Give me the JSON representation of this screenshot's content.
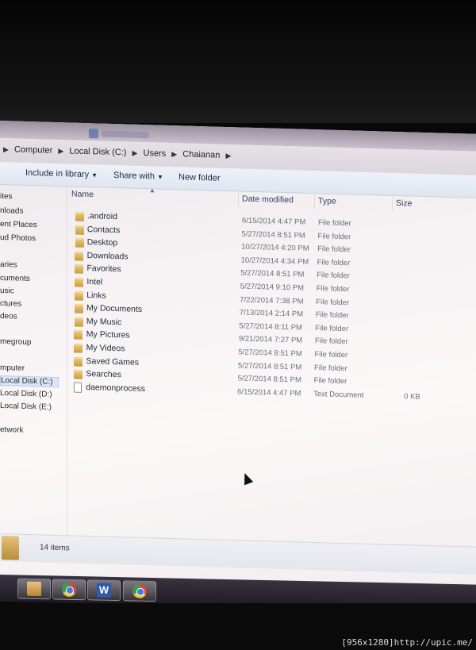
{
  "breadcrumb": [
    "Computer",
    "Local Disk (C:)",
    "Users",
    "Chaianan"
  ],
  "toolbar": {
    "include_in_library": "Include in library",
    "share_with": "Share with",
    "new_folder": "New folder"
  },
  "nav_pane": [
    "ites",
    "nloads",
    "ent Places",
    "ud Photos",
    "aries",
    "cuments",
    "usic",
    "ctures",
    "deos",
    "megroup",
    "mputer",
    "Local Disk (C:)",
    "Local Disk (D:)",
    "Local Disk (E:)",
    "etwork"
  ],
  "columns": {
    "name": "Name",
    "date": "Date modified",
    "type": "Type",
    "size": "Size"
  },
  "files": [
    {
      "name": ".android",
      "date": "6/15/2014 4:47 PM",
      "type": "File folder",
      "size": "",
      "icon": "folder-icon"
    },
    {
      "name": "Contacts",
      "date": "5/27/2014 8:51 PM",
      "type": "File folder",
      "size": "",
      "icon": "contacts-folder-icon"
    },
    {
      "name": "Desktop",
      "date": "10/27/2014 4:20 PM",
      "type": "File folder",
      "size": "",
      "icon": "desktop-folder-icon"
    },
    {
      "name": "Downloads",
      "date": "10/27/2014 4:34 PM",
      "type": "File folder",
      "size": "",
      "icon": "downloads-folder-icon"
    },
    {
      "name": "Favorites",
      "date": "5/27/2014 8:51 PM",
      "type": "File folder",
      "size": "",
      "icon": "favorites-folder-icon"
    },
    {
      "name": "Intel",
      "date": "5/27/2014 9:10 PM",
      "type": "File folder",
      "size": "",
      "icon": "folder-icon"
    },
    {
      "name": "Links",
      "date": "7/22/2014 7:38 PM",
      "type": "File folder",
      "size": "",
      "icon": "links-folder-icon"
    },
    {
      "name": "My Documents",
      "date": "7/13/2014 2:14 PM",
      "type": "File folder",
      "size": "",
      "icon": "documents-folder-icon"
    },
    {
      "name": "My Music",
      "date": "5/27/2014 8:11 PM",
      "type": "File folder",
      "size": "",
      "icon": "music-folder-icon"
    },
    {
      "name": "My Pictures",
      "date": "9/21/2014 7:27 PM",
      "type": "File folder",
      "size": "",
      "icon": "pictures-folder-icon"
    },
    {
      "name": "My Videos",
      "date": "5/27/2014 8:51 PM",
      "type": "File folder",
      "size": "",
      "icon": "videos-folder-icon"
    },
    {
      "name": "Saved Games",
      "date": "5/27/2014 8:51 PM",
      "type": "File folder",
      "size": "",
      "icon": "saved-games-folder-icon"
    },
    {
      "name": "Searches",
      "date": "5/27/2014 8:51 PM",
      "type": "File folder",
      "size": "",
      "icon": "searches-folder-icon"
    },
    {
      "name": "daemonprocess",
      "date": "6/15/2014 4:47 PM",
      "type": "Text Document",
      "size": "0 KB",
      "icon": "text-document-icon"
    }
  ],
  "status": {
    "item_count": "14 items"
  },
  "taskbar": [
    "chrome-icon",
    "explorer-folder-icon",
    "word-icon",
    "chrome-icon"
  ],
  "watermark": "[956x1280]http://upic.me/"
}
